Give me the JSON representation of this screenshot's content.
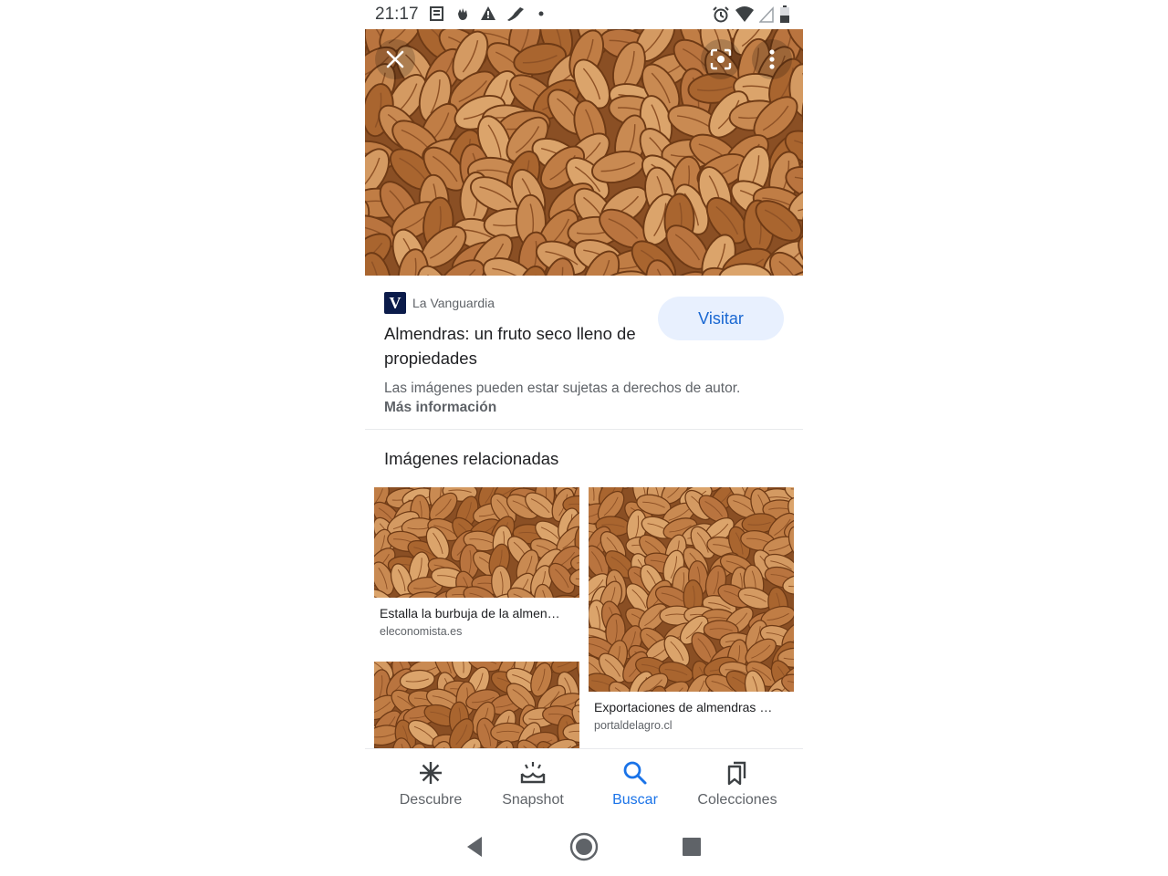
{
  "status_bar": {
    "time": "21:17",
    "left_icons": [
      "news-icon",
      "hand-icon",
      "warning-icon",
      "bird-icon",
      "dot-icon"
    ],
    "right_icons": [
      "alarm-icon",
      "wifi-icon",
      "cell-signal-icon",
      "battery-icon"
    ]
  },
  "hero": {
    "close_icon": "close-icon",
    "lens_icon": "lens-icon",
    "more_icon": "more-vert-icon"
  },
  "result": {
    "source_logo": "V",
    "source_name": "La Vanguardia",
    "title": "Almendras: un fruto seco lleno de propiedades",
    "visit_label": "Visitar",
    "notice_text": "Las imágenes pueden estar sujetas a derechos de autor.",
    "notice_link": "Más información"
  },
  "related": {
    "heading": "Imágenes relacionadas",
    "items": [
      {
        "title": "Estalla la burbuja de la almen…",
        "source": "eleconomista.es"
      },
      {
        "title": "Exportaciones de almendras …",
        "source": "portaldelagro.cl"
      },
      {
        "title": "",
        "source": ""
      }
    ]
  },
  "bottom_nav": {
    "items": [
      {
        "label": "Descubre",
        "icon": "asterisk-icon"
      },
      {
        "label": "Snapshot",
        "icon": "snapshot-icon"
      },
      {
        "label": "Buscar",
        "icon": "search-icon",
        "active": true
      },
      {
        "label": "Colecciones",
        "icon": "bookmarks-icon"
      }
    ]
  },
  "colors": {
    "accent": "#1a73e8",
    "visit_button_bg": "#e8f0fe",
    "almond": "#b8733f"
  },
  "system_nav": [
    "back-icon",
    "home-icon",
    "recents-icon"
  ]
}
